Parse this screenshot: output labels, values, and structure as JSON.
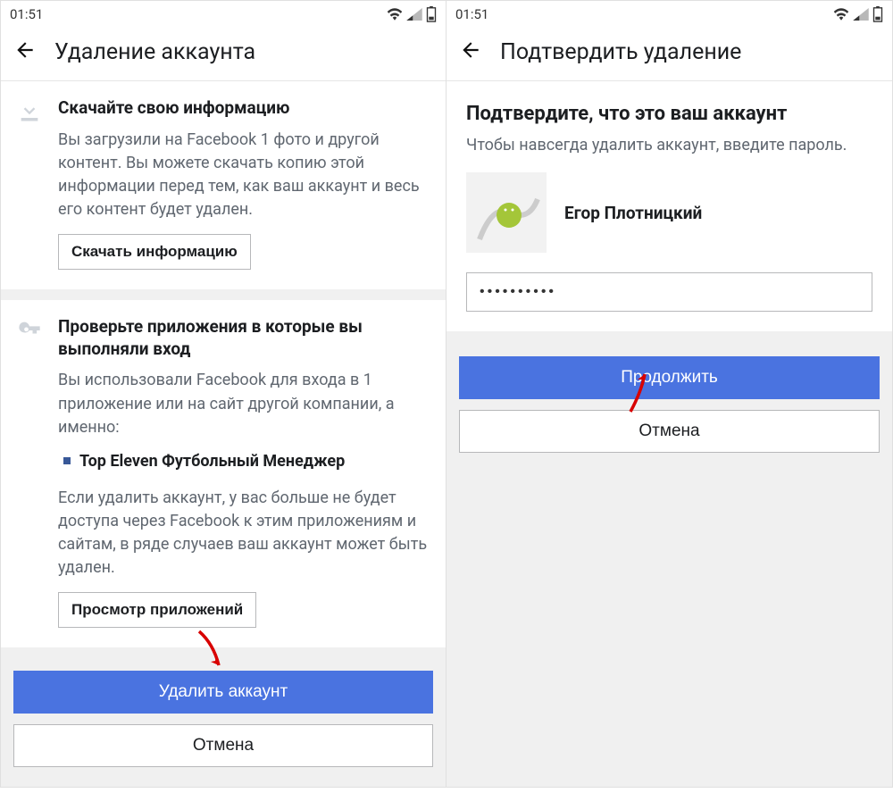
{
  "left": {
    "status_time": "01:51",
    "title": "Удаление аккаунта",
    "section1": {
      "heading": "Скачайте свою информацию",
      "text": "Вы загрузили на Facebook 1 фото и другой контент. Вы можете скачать копию этой информации перед тем, как ваш аккаунт и весь его контент будет удален.",
      "button": "Скачать информацию"
    },
    "section2": {
      "heading": "Проверьте приложения в которые вы выполняли вход",
      "text1": "Вы использовали Facebook для входа в 1 приложение или на сайт другой компании, а именно:",
      "app": "Top Eleven Футбольный Менеджер",
      "text2": "Если удалить аккаунт, у вас больше не будет доступа через Facebook к этим приложениям и сайтам, в ряде случаев ваш аккаунт может быть удален.",
      "button": "Просмотр приложений"
    },
    "primary_btn": "Удалить аккаунт",
    "secondary_btn": "Отмена"
  },
  "right": {
    "status_time": "01:51",
    "title": "Подтвердить удаление",
    "confirm_heading": "Подтвердите, что это ваш аккаунт",
    "confirm_sub": "Чтобы навсегда удалить аккаунт, введите пароль.",
    "user_name": "Егор Плотницкий",
    "password_value": "••••••••••",
    "primary_btn": "Продолжить",
    "secondary_btn": "Отмена"
  }
}
